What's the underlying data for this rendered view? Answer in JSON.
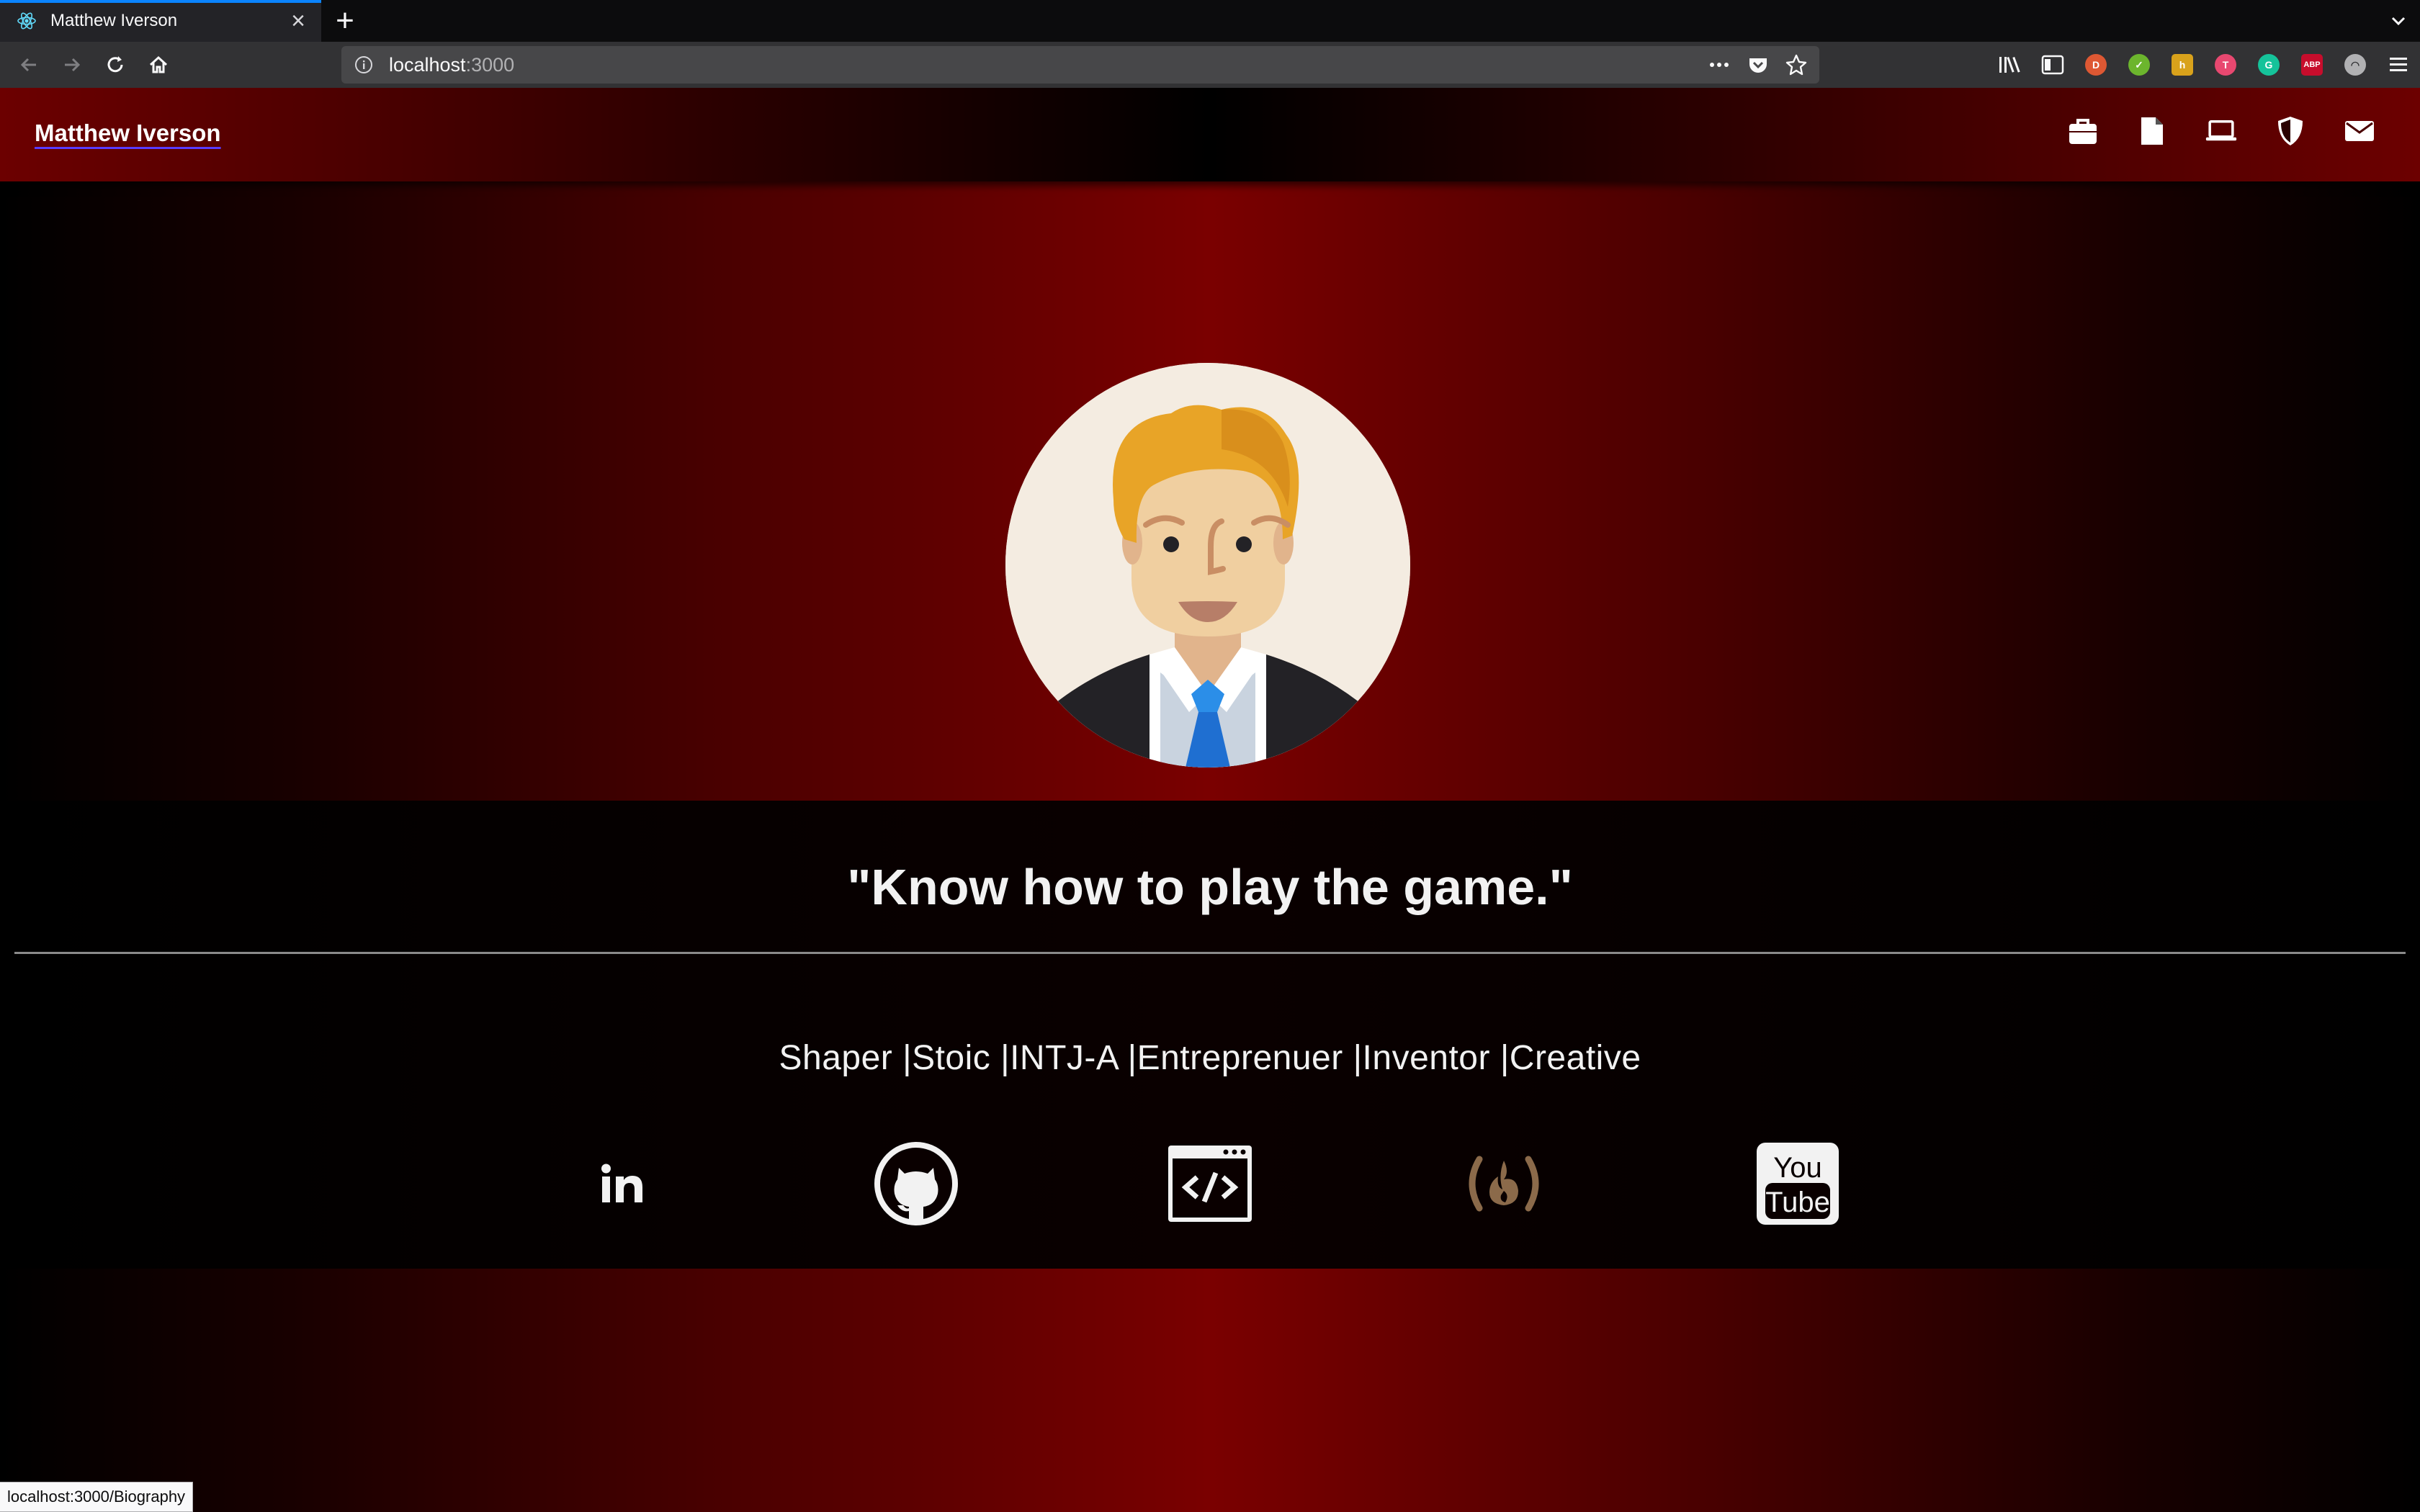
{
  "browser": {
    "tab_title": "Matthew Iverson",
    "new_tab_label": "+",
    "url_host": "localhost",
    "url_port": ":3000",
    "status_url": "localhost:3000/Biography"
  },
  "site": {
    "brand": "Matthew Iverson",
    "nav_icons": [
      "briefcase-icon",
      "document-icon",
      "laptop-icon",
      "shield-icon",
      "envelope-icon"
    ],
    "quote": "\"Know how to play the game.\"",
    "traits": "Shaper |Stoic |INTJ-A |Entreprenuer |Inventor |Creative",
    "socials": [
      "linkedin-icon",
      "github-icon",
      "code-window-icon",
      "freecodecamp-icon",
      "youtube-icon"
    ],
    "colors": {
      "accent_red": "#7a0000",
      "text": "#f2f2f2",
      "freecodecamp": "#8b6a4a"
    }
  }
}
